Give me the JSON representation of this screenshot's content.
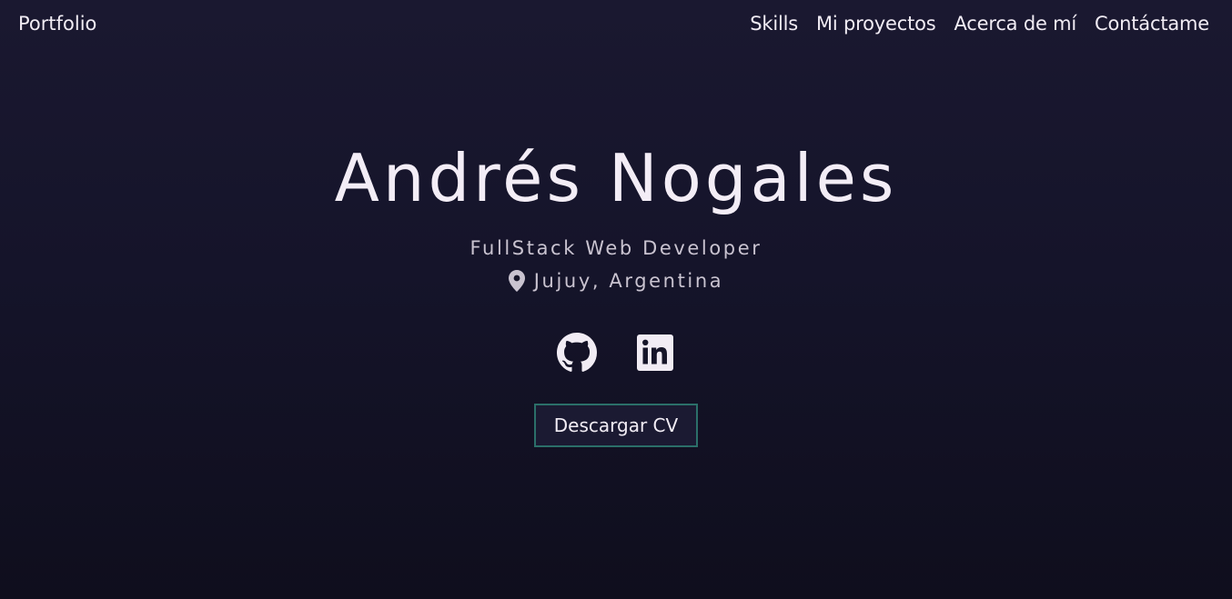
{
  "nav": {
    "brand": "Portfolio",
    "links": [
      "Skills",
      "Mi proyectos",
      "Acerca de mí",
      "Contáctame"
    ]
  },
  "hero": {
    "name": "Andrés Nogales",
    "role": "FullStack Web Developer",
    "location": "Jujuy, Argentina",
    "location_icon": "map-pin-icon",
    "socials": [
      {
        "icon": "github-icon"
      },
      {
        "icon": "linkedin-icon"
      }
    ],
    "cv_button": "Descargar CV"
  },
  "colors": {
    "background_top": "#1a1830",
    "background_bottom": "#0f0e1d",
    "text": "#f1ecf4",
    "muted_text": "#c9c3d0",
    "button_border": "#2b6f69",
    "button_bg": "#1b1a32"
  }
}
